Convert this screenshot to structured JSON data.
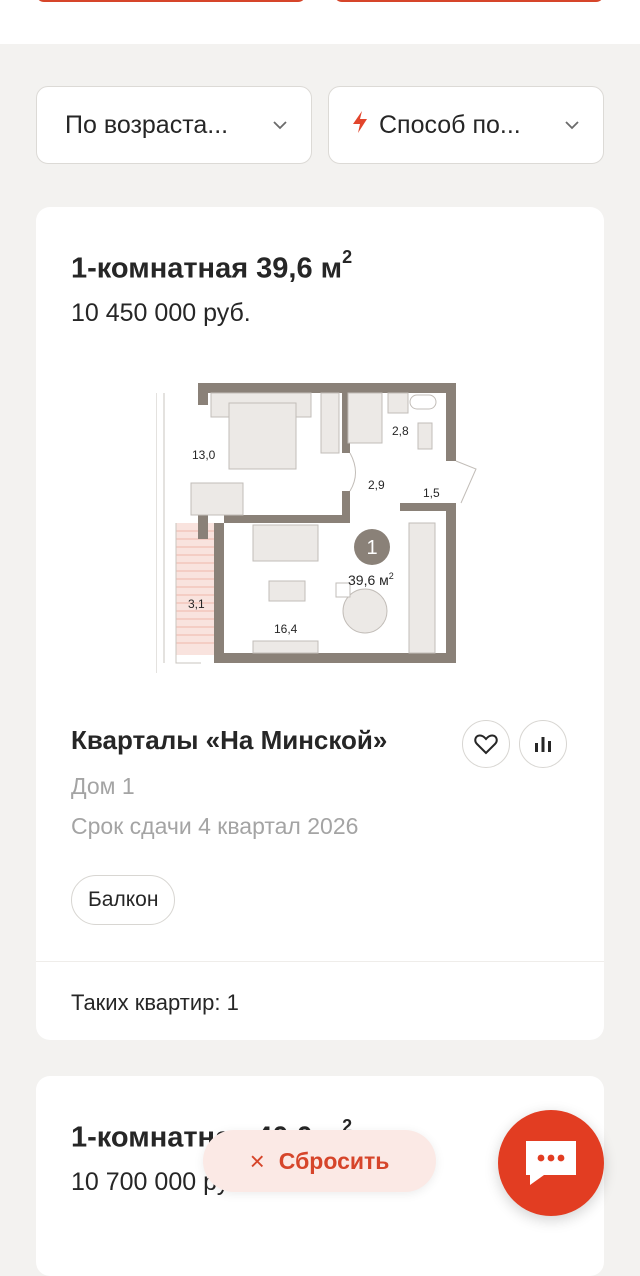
{
  "filters": {
    "sort_label": "По возраста...",
    "method_label": "Способ по..."
  },
  "listing1": {
    "title": "1-комнатная 39,6 м",
    "title_sup": "2",
    "price": "10 450 000 руб.",
    "plan": {
      "room_number": "1",
      "total_area": "39,6 м",
      "total_area_sup": "2",
      "areas": {
        "bedroom": "13,0",
        "bath": "2,8",
        "hall": "2,9",
        "entry": "1,5",
        "balcony": "3,1",
        "living": "16,4"
      }
    },
    "complex": "Кварталы «На Минской»",
    "house": "Дом 1",
    "deadline": "Срок сдачи 4 квартал 2026",
    "tag": "Балкон",
    "count": "Таких квартир: 1"
  },
  "listing2": {
    "title": "1-комнатная 40,0 м",
    "title_sup": "2",
    "price": "10 700 000 руб."
  },
  "actions": {
    "reset_label": "Сбросить",
    "reset_icon": "×"
  },
  "colors": {
    "accent": "#e23d22",
    "wall": "#8a8178"
  }
}
